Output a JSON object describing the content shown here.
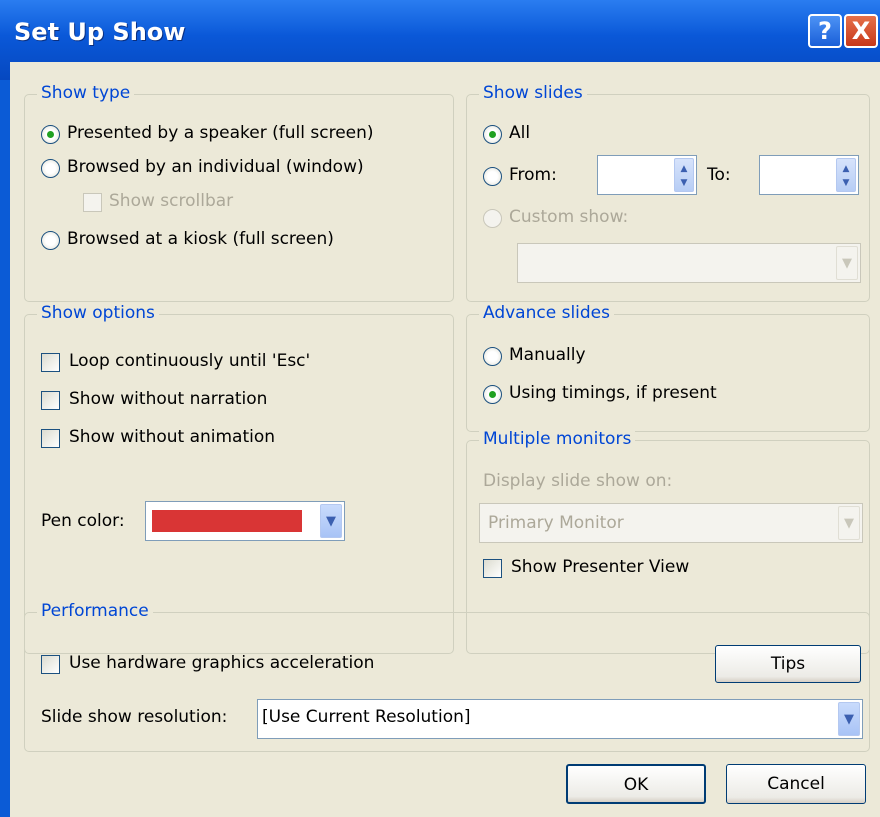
{
  "window": {
    "title": "Set Up Show",
    "help_label": "?",
    "close_label": "X"
  },
  "show_type": {
    "legend": "Show type",
    "options": [
      {
        "label": "Presented by a speaker (full screen)",
        "selected": true,
        "enabled": true
      },
      {
        "label": "Browsed by an individual (window)",
        "selected": false,
        "enabled": true
      },
      {
        "label": "Browsed at a kiosk (full screen)",
        "selected": false,
        "enabled": true
      }
    ],
    "show_scrollbar": {
      "label": "Show scrollbar",
      "checked": false,
      "enabled": false
    }
  },
  "show_slides": {
    "legend": "Show slides",
    "all_label": "All",
    "all_selected": true,
    "from_label": "From:",
    "from_value": "",
    "to_label": "To:",
    "to_value": "",
    "custom_show_label": "Custom show:",
    "custom_show_value": ""
  },
  "show_options": {
    "legend": "Show options",
    "checkboxes": [
      {
        "label": "Loop continuously until 'Esc'",
        "checked": false
      },
      {
        "label": "Show without narration",
        "checked": false
      },
      {
        "label": "Show without animation",
        "checked": false
      }
    ],
    "pen_color_label": "Pen color:",
    "pen_color": "#d93535"
  },
  "advance_slides": {
    "legend": "Advance slides",
    "manually_label": "Manually",
    "using_timings_label": "Using timings, if present",
    "selected": "using_timings"
  },
  "multiple_monitors": {
    "legend": "Multiple monitors",
    "display_on_label": "Display slide show on:",
    "monitor_value": "Primary Monitor",
    "presenter_view_label": "Show Presenter View",
    "presenter_view_checked": false
  },
  "performance": {
    "legend": "Performance",
    "hw_accel_label": "Use hardware graphics acceleration",
    "hw_accel_checked": false,
    "tips_label": "Tips",
    "resolution_label": "Slide show resolution:",
    "resolution_value": "[Use Current Resolution]"
  },
  "buttons": {
    "ok_label": "OK",
    "cancel_label": "Cancel"
  },
  "icons": {
    "dropdown": "chevron-down-icon",
    "spinner": "spinner-arrows-icon",
    "help": "help-icon",
    "close": "close-icon"
  }
}
